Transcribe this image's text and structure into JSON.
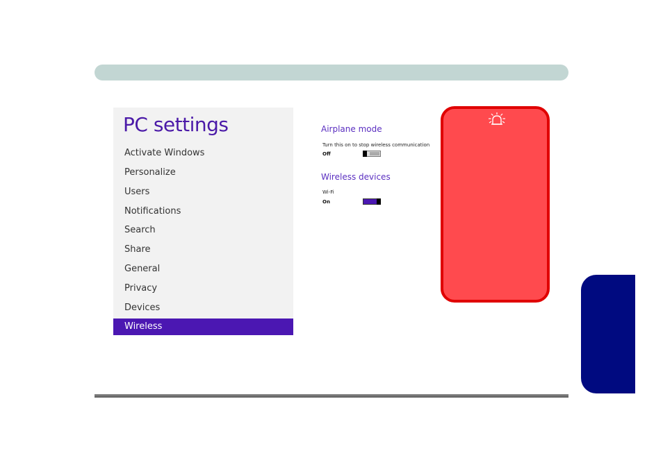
{
  "settings": {
    "title": "PC settings",
    "nav_items": [
      {
        "label": "Activate Windows"
      },
      {
        "label": "Personalize"
      },
      {
        "label": "Users"
      },
      {
        "label": "Notifications"
      },
      {
        "label": "Search"
      },
      {
        "label": "Share"
      },
      {
        "label": "General"
      },
      {
        "label": "Privacy"
      },
      {
        "label": "Devices"
      },
      {
        "label": "Wireless",
        "active": true
      }
    ]
  },
  "airplane": {
    "title": "Airplane mode",
    "description": "Turn this on to stop wireless communication",
    "state": "Off"
  },
  "wireless": {
    "title": "Wireless devices",
    "wifi_label": "Wi-Fi",
    "state": "On"
  },
  "overlay": {
    "icon": "alarm-bell-icon",
    "fill_color": "#ff4a4e",
    "border_color": "#e00000"
  },
  "colors": {
    "accent": "#4b17b2",
    "side_tab": "#000a80",
    "top_bar": "#c2d6d3"
  }
}
